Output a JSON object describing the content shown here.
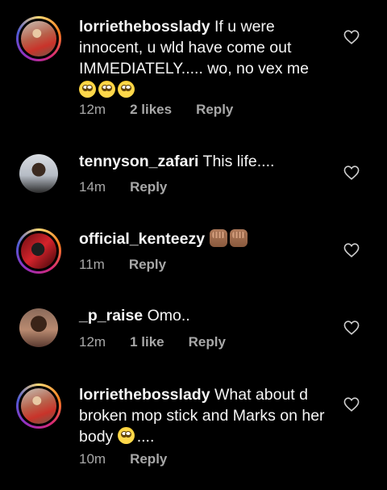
{
  "comments": [
    {
      "username": "lorriethebosslady",
      "text": "If u were innocent, u wld have come out IMMEDIATELY..... wo, no vex me",
      "emojis": "🙄🙄🙄",
      "time": "12m",
      "likes": "2 likes",
      "reply": "Reply",
      "story_ring": true
    },
    {
      "username": "tennyson_zafari",
      "text": "This life....",
      "time": "14m",
      "reply": "Reply",
      "story_ring": false
    },
    {
      "username": "official_kenteezy",
      "text": "",
      "emojis": "✊🏽✊🏽",
      "time": "11m",
      "reply": "Reply",
      "story_ring": true
    },
    {
      "username": "_p_raise",
      "text": "Omo..",
      "time": "12m",
      "likes": "1 like",
      "reply": "Reply",
      "story_ring": false
    },
    {
      "username": "lorriethebosslady",
      "text": "What about d broken mop stick and Marks on her body",
      "emojis": "🙄....",
      "time": "10m",
      "reply": "Reply",
      "story_ring": true
    }
  ],
  "icons": {
    "like": "heart-outline-icon"
  }
}
